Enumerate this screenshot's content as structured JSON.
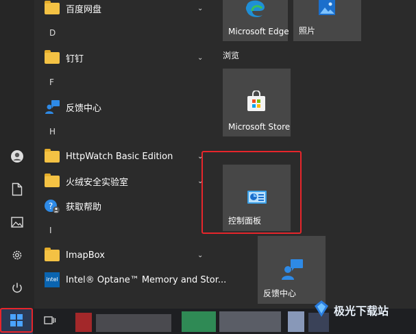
{
  "left_rail": {
    "items": [
      {
        "name": "user-account",
        "icon": "user-icon"
      },
      {
        "name": "documents",
        "icon": "document-icon"
      },
      {
        "name": "pictures",
        "icon": "pictures-icon"
      },
      {
        "name": "settings",
        "icon": "gear-icon"
      },
      {
        "name": "power",
        "icon": "power-icon"
      }
    ]
  },
  "app_list": {
    "rows": [
      {
        "type": "app",
        "label": "百度网盘",
        "icon": "folder-icon",
        "expand": true
      },
      {
        "type": "letter",
        "label": "D"
      },
      {
        "type": "app",
        "label": "钉钉",
        "icon": "folder-icon",
        "expand": true
      },
      {
        "type": "letter",
        "label": "F"
      },
      {
        "type": "app",
        "label": "反馈中心",
        "icon": "feedback-hub-icon",
        "expand": false
      },
      {
        "type": "letter",
        "label": "H"
      },
      {
        "type": "app",
        "label": "HttpWatch Basic Edition",
        "icon": "folder-icon",
        "expand": true
      },
      {
        "type": "app",
        "label": "火绒安全实验室",
        "icon": "folder-icon",
        "expand": true
      },
      {
        "type": "app",
        "label": "获取帮助",
        "icon": "get-help-icon",
        "expand": false
      },
      {
        "type": "letter",
        "label": "I"
      },
      {
        "type": "app",
        "label": "ImapBox",
        "icon": "folder-icon",
        "expand": true
      },
      {
        "type": "app",
        "label": "Intel® Optane™ Memory and Stor...",
        "icon": "intel-icon",
        "expand": false
      }
    ]
  },
  "tiles": {
    "microsoft_edge": "Microsoft Edge",
    "photos": "照片",
    "browse_group": "浏览",
    "microsoft_store": "Microsoft Store",
    "control_panel": "控制面板",
    "feedback_hub": "反馈中心"
  },
  "watermark": "极光下载站",
  "colors": {
    "highlight_red": "#e8252b",
    "tile_bg": "#474747",
    "panel_bg": "#2b2b2b",
    "folder_yellow": "#f4c244",
    "accent_blue": "#0078d4"
  }
}
